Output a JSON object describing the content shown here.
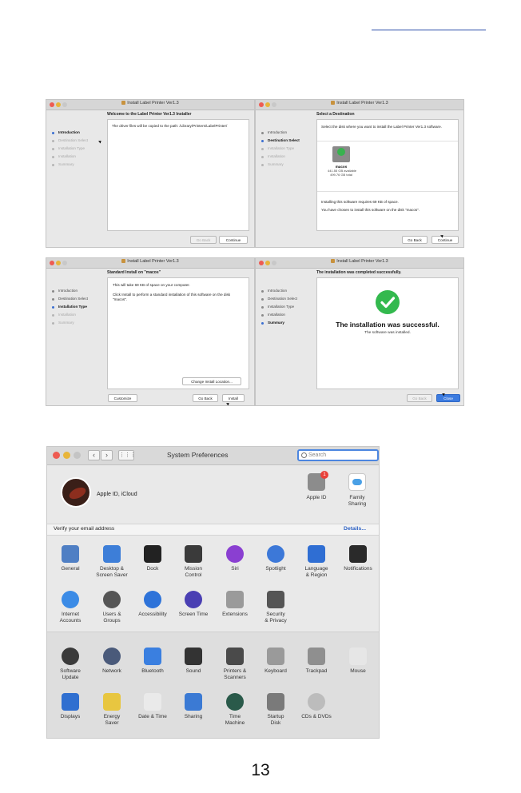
{
  "installer": {
    "window_title": "Install Label Printer Ver1.3",
    "steps": [
      "Introduction",
      "Destination Select",
      "Installation Type",
      "Installation",
      "Summary"
    ],
    "w1": {
      "heading": "Welcome to the Label Printer Ver1.3 Installer",
      "body": "The driver files will be copied to the path: /Library/Printers/LabelPrinter/",
      "back": "Go Back",
      "continue": "Continue"
    },
    "w2": {
      "heading": "Select a Destination",
      "prompt": "Select the disk where you want to install the Label Printer Ver1.3 software.",
      "disk_name": "macos",
      "disk_available": "441.55 GB available",
      "disk_total": "499.76 GB total",
      "req": "Installing this software requires 69 KB of space.",
      "chosen": "You have chosen to install this software on the disk \"macos\".",
      "back": "Go Back",
      "continue": "Continue"
    },
    "w3": {
      "heading": "Standard Install on \"macos\"",
      "line1": "This will take 69 KB of space on your computer.",
      "line2": "Click Install to perform a standard installation of this software on the disk \"macos\".",
      "change": "Change Install Location...",
      "customize": "Customize",
      "back": "Go Back",
      "install": "Install"
    },
    "w4": {
      "heading": "The installation was completed successfully.",
      "big": "The installation was successful.",
      "small": "The software was installed.",
      "back": "Go Back",
      "close": "Close"
    }
  },
  "sysprefs": {
    "title": "System Preferences",
    "search_placeholder": "Search",
    "apple_id_label": "Apple ID, iCloud",
    "apple_id_badge": "1",
    "apple_id": "Apple ID",
    "family_sharing": "Family\nSharing",
    "verify_label": "Verify your email address",
    "details_link": "Details...",
    "row1": [
      "General",
      "Desktop &\nScreen Saver",
      "Dock",
      "Mission\nControl",
      "Siri",
      "Spotlight",
      "Language\n& Region",
      "Notifications"
    ],
    "row2": [
      "Internet\nAccounts",
      "Users &\nGroups",
      "Accessibility",
      "Screen Time",
      "Extensions",
      "Security\n& Privacy"
    ],
    "row3": [
      "Software\nUpdate",
      "Network",
      "Bluetooth",
      "Sound",
      "Printers &\nScanners",
      "Keyboard",
      "Trackpad",
      "Mouse"
    ],
    "row4": [
      "Displays",
      "Energy\nSaver",
      "Date & Time",
      "Sharing",
      "Time\nMachine",
      "Startup\nDisk",
      "CDs & DVDs"
    ],
    "icon_colors": {
      "row1": [
        "#4f7fc4",
        "#3d7ed8",
        "#222222",
        "#3a3a3a",
        "#8a3fd1",
        "#3c78d8",
        "#2f6ed3",
        "#2a2a2a"
      ],
      "row2": [
        "#3b8be6",
        "#555555",
        "#2e73d9",
        "#4a3fb3",
        "#9a9a9a",
        "#555555"
      ],
      "row3": [
        "#3a3a3a",
        "#4a5a7a",
        "#3a7fe0",
        "#333333",
        "#4a4a4a",
        "#9a9a9a",
        "#8f8f8f",
        "#e6e6e6"
      ],
      "row4": [
        "#2f6fd0",
        "#e8c640",
        "#eaeaea",
        "#3b7ad4",
        "#2a5a4a",
        "#7a7a7a",
        "#bcbcbc"
      ]
    }
  },
  "page_number": "13",
  "colors": {
    "accent": "#3d7ce0",
    "success": "#33b94e",
    "link": "#2e62c4"
  }
}
